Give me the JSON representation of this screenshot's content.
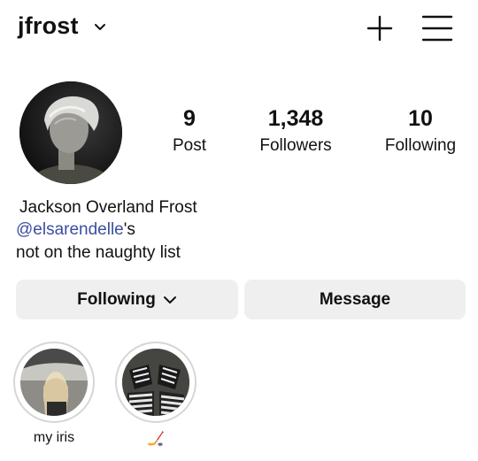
{
  "header": {
    "username": "jfrost",
    "dropdown_icon": "chevron-down-icon",
    "new_post_icon": "plus-icon",
    "menu_icon": "hamburger-menu-icon"
  },
  "profile": {
    "avatar": "profile-photo",
    "stats": {
      "posts": {
        "value": "9",
        "label": "Post"
      },
      "followers": {
        "value": "1,348",
        "label": "Followers"
      },
      "following": {
        "value": "10",
        "label": "Following"
      }
    },
    "bio": {
      "name": "Jackson Overland Frost",
      "mention": "@elsarendelle",
      "mention_suffix": "'s",
      "line": "not on the naughty list"
    }
  },
  "actions": {
    "following_label": "Following",
    "message_label": "Message"
  },
  "highlights": [
    {
      "label": "my iris"
    },
    {
      "label": "🏒"
    }
  ],
  "colors": {
    "link": "#3c4ea0",
    "button_bg": "#efefef",
    "ring": "#d6d6d6"
  }
}
